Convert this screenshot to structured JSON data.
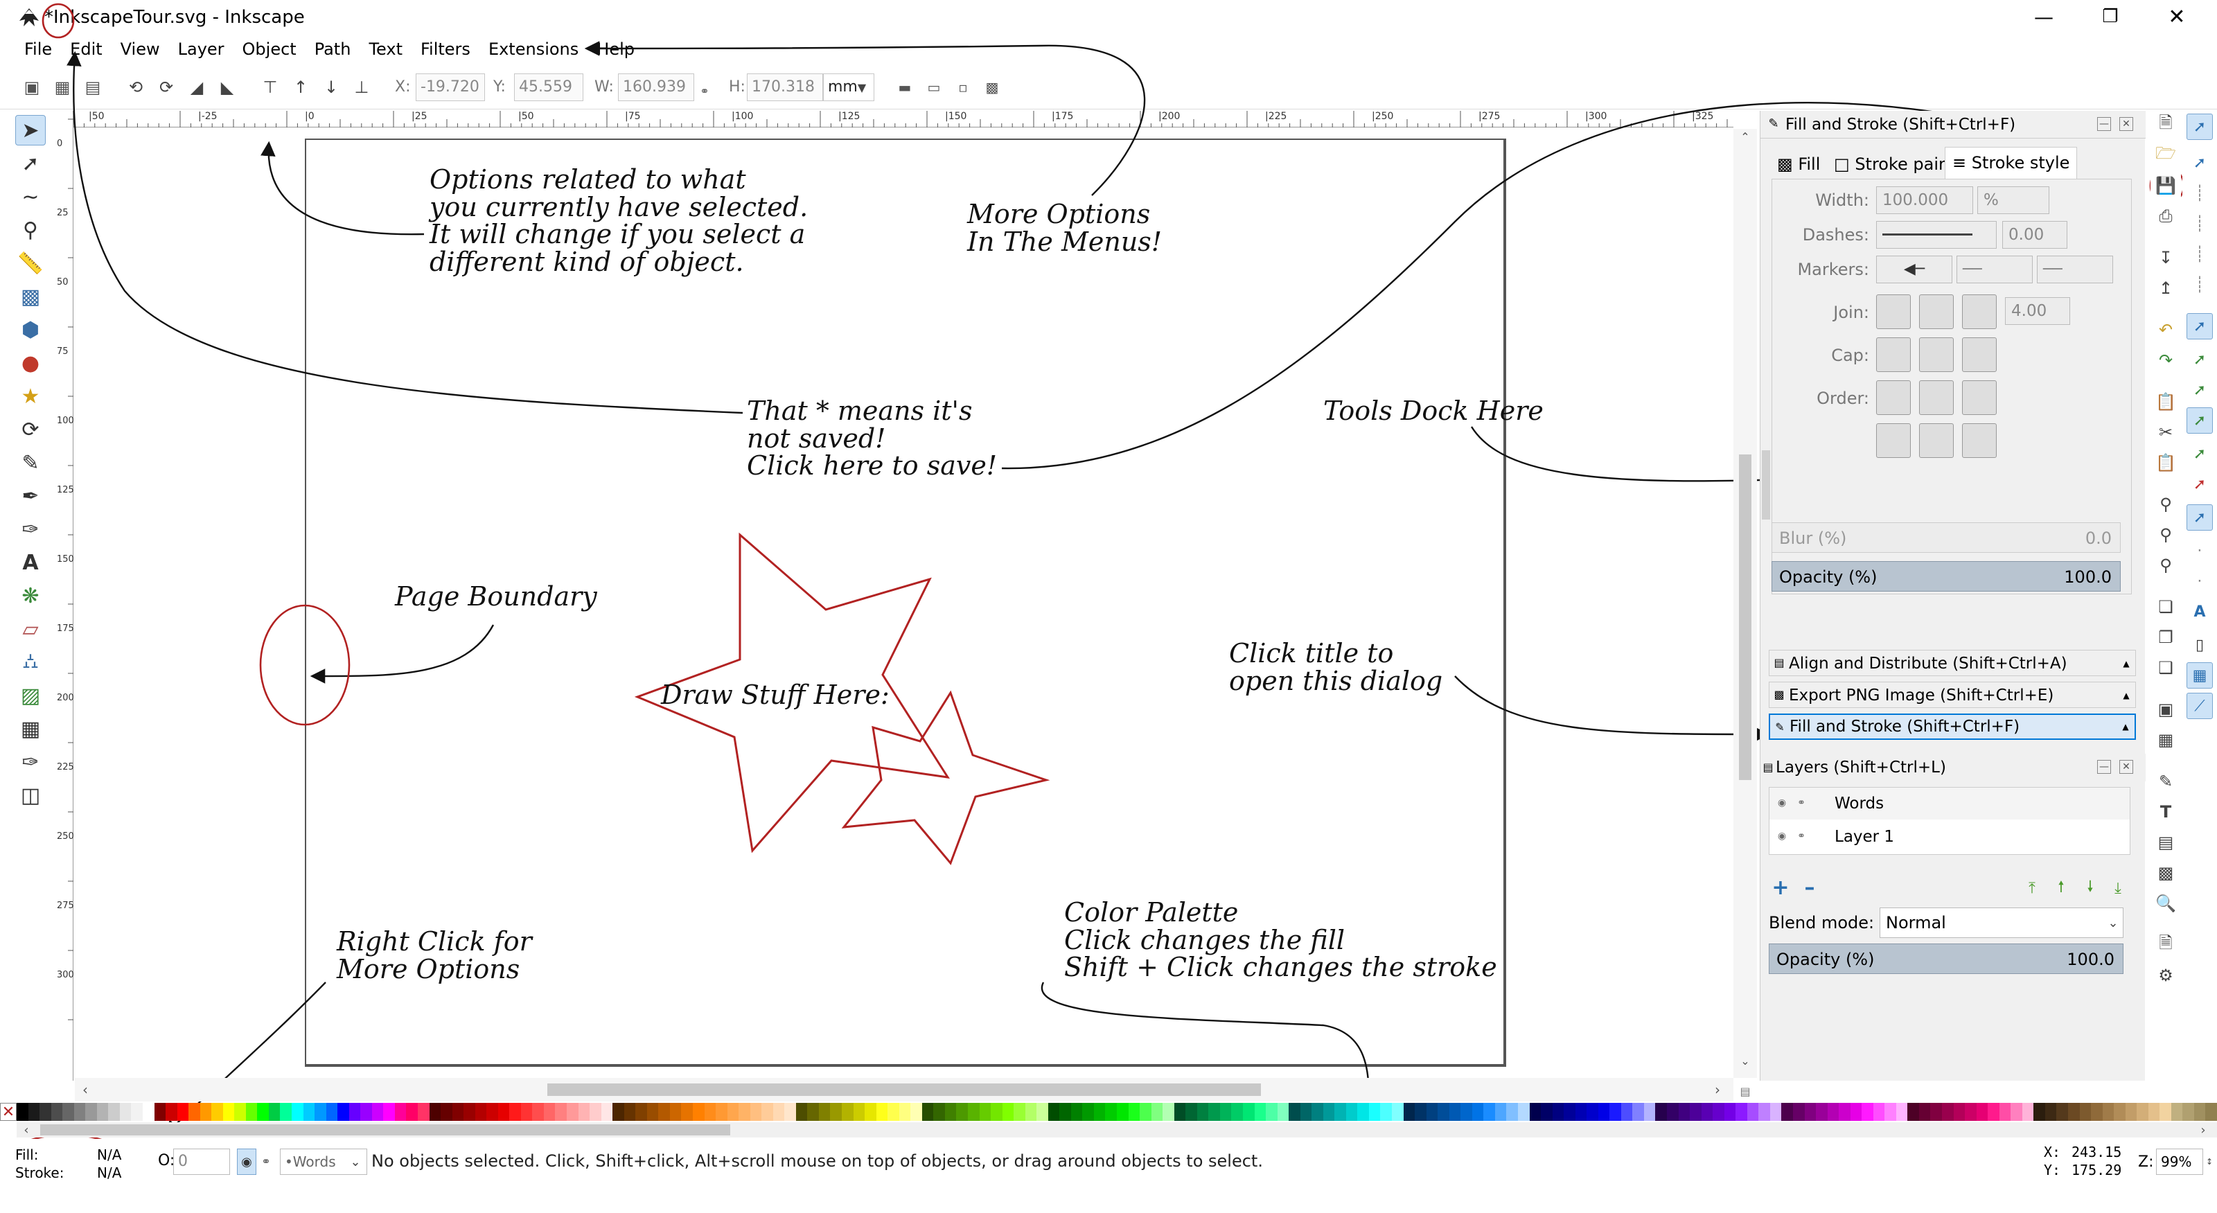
{
  "window": {
    "title": "*InkscapeTour.svg - Inkscape",
    "controls": [
      "—",
      "❐",
      "✕"
    ]
  },
  "menu": [
    "File",
    "Edit",
    "View",
    "Layer",
    "Object",
    "Path",
    "Text",
    "Filters",
    "Extensions",
    "Help"
  ],
  "toolbar": {
    "x_label": "X:",
    "x": "-19.720",
    "y_label": "Y:",
    "y": "45.559",
    "w_label": "W:",
    "w": "160.939",
    "h_label": "H:",
    "h": "170.318",
    "unit": "mm"
  },
  "ruler": {
    "h_labels": [
      "|50",
      "|-25",
      "|0",
      "|25",
      "|50",
      "|75",
      "|100",
      "|125",
      "|150",
      "|175",
      "|200",
      "|225",
      "|250",
      "|275",
      "|300",
      "|325"
    ],
    "v_labels": [
      "0",
      "25",
      "50",
      "75",
      "100",
      "125",
      "150",
      "175",
      "200",
      "225",
      "250",
      "275",
      "300"
    ]
  },
  "annotations": {
    "options": "Options related to what\nyou currently have selected.\nIt will change if you select a\ndifferent kind of object.",
    "menus": "More Options\nIn The Menus!",
    "star": "That * means it's\nnot saved!\nClick here to save!",
    "dock": "Tools Dock Here",
    "page": "Page Boundary",
    "draw": "Draw Stuff Here:",
    "title": "Click title to\nopen this dialog",
    "palette": "Color Palette\nClick changes the fill\nShift + Click changes the stroke",
    "right": "Right Click for\nMore Options"
  },
  "fill_stroke": {
    "title": "Fill and Stroke (Shift+Ctrl+F)",
    "tabs": [
      "Fill",
      "Stroke paint",
      "Stroke style"
    ],
    "width_label": "Width:",
    "width": "100.000",
    "width_unit": "%",
    "dashes_label": "Dashes:",
    "dashes": "0.00",
    "markers_label": "Markers:",
    "join_label": "Join:",
    "join_value": "4.00",
    "cap_label": "Cap:",
    "order_label": "Order:",
    "blur_label": "Blur (%)",
    "blur": "0.0",
    "opacity_label": "Opacity (%)",
    "opacity": "100.0"
  },
  "dialogs": {
    "align": "Align and Distribute (Shift+Ctrl+A)",
    "export": "Export PNG Image (Shift+Ctrl+E)",
    "fill": "Fill and Stroke (Shift+Ctrl+F)"
  },
  "layers": {
    "title": "Layers (Shift+Ctrl+L)",
    "items": [
      "Words",
      "Layer 1"
    ],
    "blend_label": "Blend mode:",
    "blend": "Normal",
    "opacity_label": "Opacity (%)",
    "opacity": "100.0"
  },
  "status": {
    "fill_label": "Fill:",
    "fill": "N/A",
    "stroke_label": "Stroke:",
    "stroke": "N/A",
    "o_label": "O:",
    "o": "0",
    "layer": "•Words",
    "message": "No objects selected. Click, Shift+click, Alt+scroll mouse on top of objects, or drag around objects to select.",
    "x_label": "X:",
    "x": "243.15",
    "y_label": "Y:",
    "y": "175.29",
    "z_label": "Z:",
    "zoom": "99%"
  },
  "colors": {
    "accent": "#0078d7",
    "annotation_circle": "#b22222",
    "star": "#b22222"
  }
}
